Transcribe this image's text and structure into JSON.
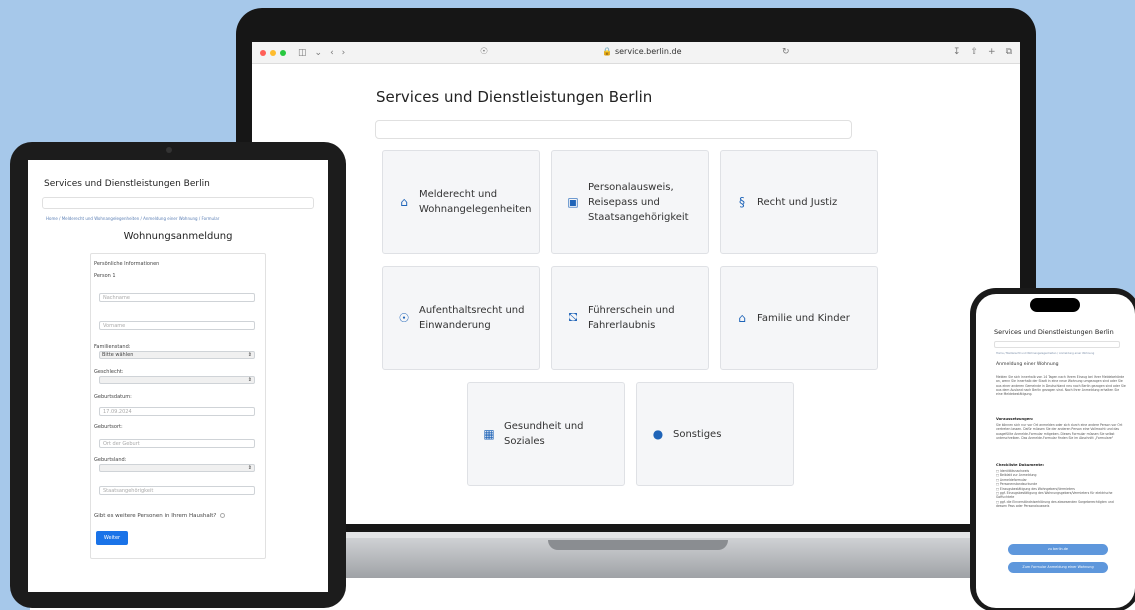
{
  "laptop": {
    "browser": {
      "url": "service.berlin.de"
    },
    "page": {
      "title": "Services und Dienstleistungen Berlin",
      "tiles": [
        {
          "label": "Melderecht und Wohnangelegenheiten",
          "icon": "home-icon"
        },
        {
          "label": "Personalausweis, Reisepass und Staatsangehörigkeit",
          "icon": "id-card-icon"
        },
        {
          "label": "Recht und Justiz",
          "icon": "paragraph-icon"
        },
        {
          "label": "Aufenthaltsrecht und Einwanderung",
          "icon": "globe-icon"
        },
        {
          "label": "Führerschein und Fahrerlaubnis",
          "icon": "car-icon"
        },
        {
          "label": "Familie und Kinder",
          "icon": "family-icon"
        },
        {
          "label": "Gesundheit und Soziales",
          "icon": "medical-kit-icon"
        },
        {
          "label": "Sonstiges",
          "icon": "chat-icon"
        }
      ]
    }
  },
  "tablet": {
    "title": "Services und Dienstleistungen Berlin",
    "breadcrumb": "Home  /  Melderecht und Wohnangelegenheiten  /  Anmeldung einer Wohnung  /  Formular",
    "heading": "Wohnungsanmeldung",
    "form": {
      "section": "Persönliche Informationen",
      "person": "Person 1",
      "nachname_placeholder": "Nachname",
      "vorname_placeholder": "Vorname",
      "familienstand_label": "Familienstand:",
      "familienstand_value": "Bitte wählen",
      "geschlecht_label": "Geschlecht:",
      "geburtsdatum_label": "Geburtsdatum:",
      "geburtsdatum_value": "17.09.2024",
      "geburtsort_label": "Geburtsort:",
      "geburtsort_placeholder": "Ort der Geburt",
      "geburtsland_label": "Geburtsland:",
      "staatsangehoerigkeit_placeholder": "Staatsangehörigkeit",
      "question": "Gibt es weitere Personen in Ihrem Haushalt?",
      "submit": "Weiter"
    }
  },
  "phone": {
    "title": "Services und Dienstleistungen Berlin",
    "breadcrumb": "Home  /  Melderecht und Wohnangelegenheiten  /  Anmeldung einer Wohnung",
    "heading": "Anmeldung einer Wohnung",
    "intro": "Melden Sie sich innerhalb von 14 Tagen nach Ihrem Einzug bei Ihrer Meldebehörde an, wenn Sie innerhalb der Stadt in eine neue Wohnung umgezogen sind oder Sie aus einer anderen Gemeinde in Deutschland neu nach Berlin gezogen sind oder Sie aus dem Ausland nach Berlin gezogen sind. Nach Ihrer Anmeldung erhalten Sie eine Meldebestätigung.",
    "voraussetzungen_title": "Voraussetzungen:",
    "voraussetzungen_text": "Sie können sich nur vor Ort anmelden oder sich durch eine andere Person vor Ort vertreten lassen. Dafür müssen Sie der anderen Person eine Vollmacht und das ausgefüllte Anmelde-Formular mitgeben. Dieses Formular müssen Sie selbst unterschreiben. Das Anmelde-Formular finden Sie im Abschnitt „Formulare\"",
    "checkliste_title": "Checkliste Dokumente:",
    "checkliste": [
      "□ Identitätsnachweis",
      "□ Beiblatt zur Anmeldung",
      "□ Anmeldeformular",
      "□ Personenstandsurkunde",
      "□ Einzugsbestätigung des Wohngebers/Vermieters",
      "□ ggf. Einzugsbestätigung des Wohnungsgebers/Vermieters für elektrische Goffuchtete",
      "□ ggf. die Einverständniserklärung des abwesenden Sorgeberechtigten und dessen Pass oder Personalausweis"
    ],
    "button_primary": "zu berlin.de",
    "button_secondary": "Zum Formular Anmeldung einer Wohnung"
  }
}
